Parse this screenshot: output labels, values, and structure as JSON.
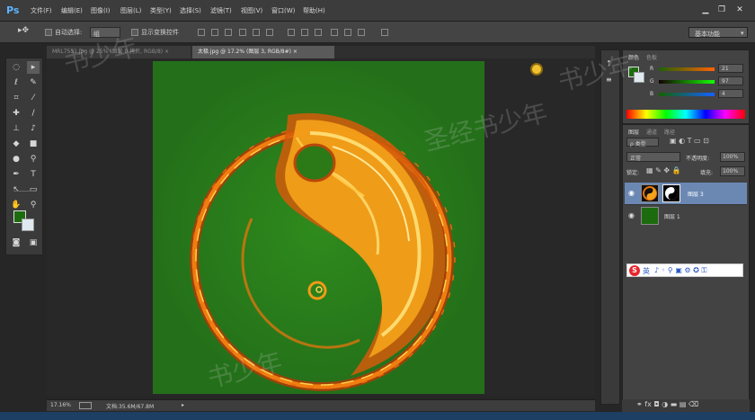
{
  "app": {
    "logo": "Ps"
  },
  "menu": [
    "文件(F)",
    "编辑(E)",
    "图像(I)",
    "图层(L)",
    "类型(Y)",
    "选择(S)",
    "滤镜(T)",
    "视图(V)",
    "窗口(W)",
    "帮助(H)"
  ],
  "window_controls": {
    "minimize": "▁",
    "restore": "❐",
    "close": "✕"
  },
  "options": {
    "auto_select_label": "自动选择:",
    "auto_select_value": "组",
    "show_transform_label": "显示变换控件",
    "workspace": "基本功能"
  },
  "tabs": [
    {
      "label": "MRL7551.jpg @ 25% (图层 0 拷贝, RGB/8) ×"
    },
    {
      "label": "太极.jpg @ 17.2% (图层 3, RGB/8#) ×"
    }
  ],
  "status": {
    "zoom": "17.16%",
    "doc": "文档:35.6M/67.8M"
  },
  "color_panel": {
    "tabs": [
      "颜色",
      "色板"
    ],
    "r_label": "R",
    "r_value": "21",
    "g_label": "G",
    "g_value": "97",
    "b_label": "B",
    "b_value": "4"
  },
  "layers_panel": {
    "tabs": [
      "图层",
      "通道",
      "路径"
    ],
    "filter_label": "ρ 类型",
    "blend_mode": "正常",
    "opacity_label": "不透明度:",
    "opacity_value": "100%",
    "lock_label": "锁定:",
    "fill_label": "填充:",
    "fill_value": "100%",
    "layers": [
      {
        "name": "图层 3",
        "selected": true
      },
      {
        "name": "图层 1",
        "selected": false
      }
    ]
  },
  "ime": {
    "logo": "S",
    "label": "英"
  },
  "watermark": [
    "书少年",
    "圣经书少年",
    "书少年",
    "书少年"
  ],
  "colors": {
    "canvas_green": "#2b7a17",
    "accent_blue": "#5fb4ff",
    "foreground": "#1d6b0f",
    "background": "#dfe9ef"
  }
}
